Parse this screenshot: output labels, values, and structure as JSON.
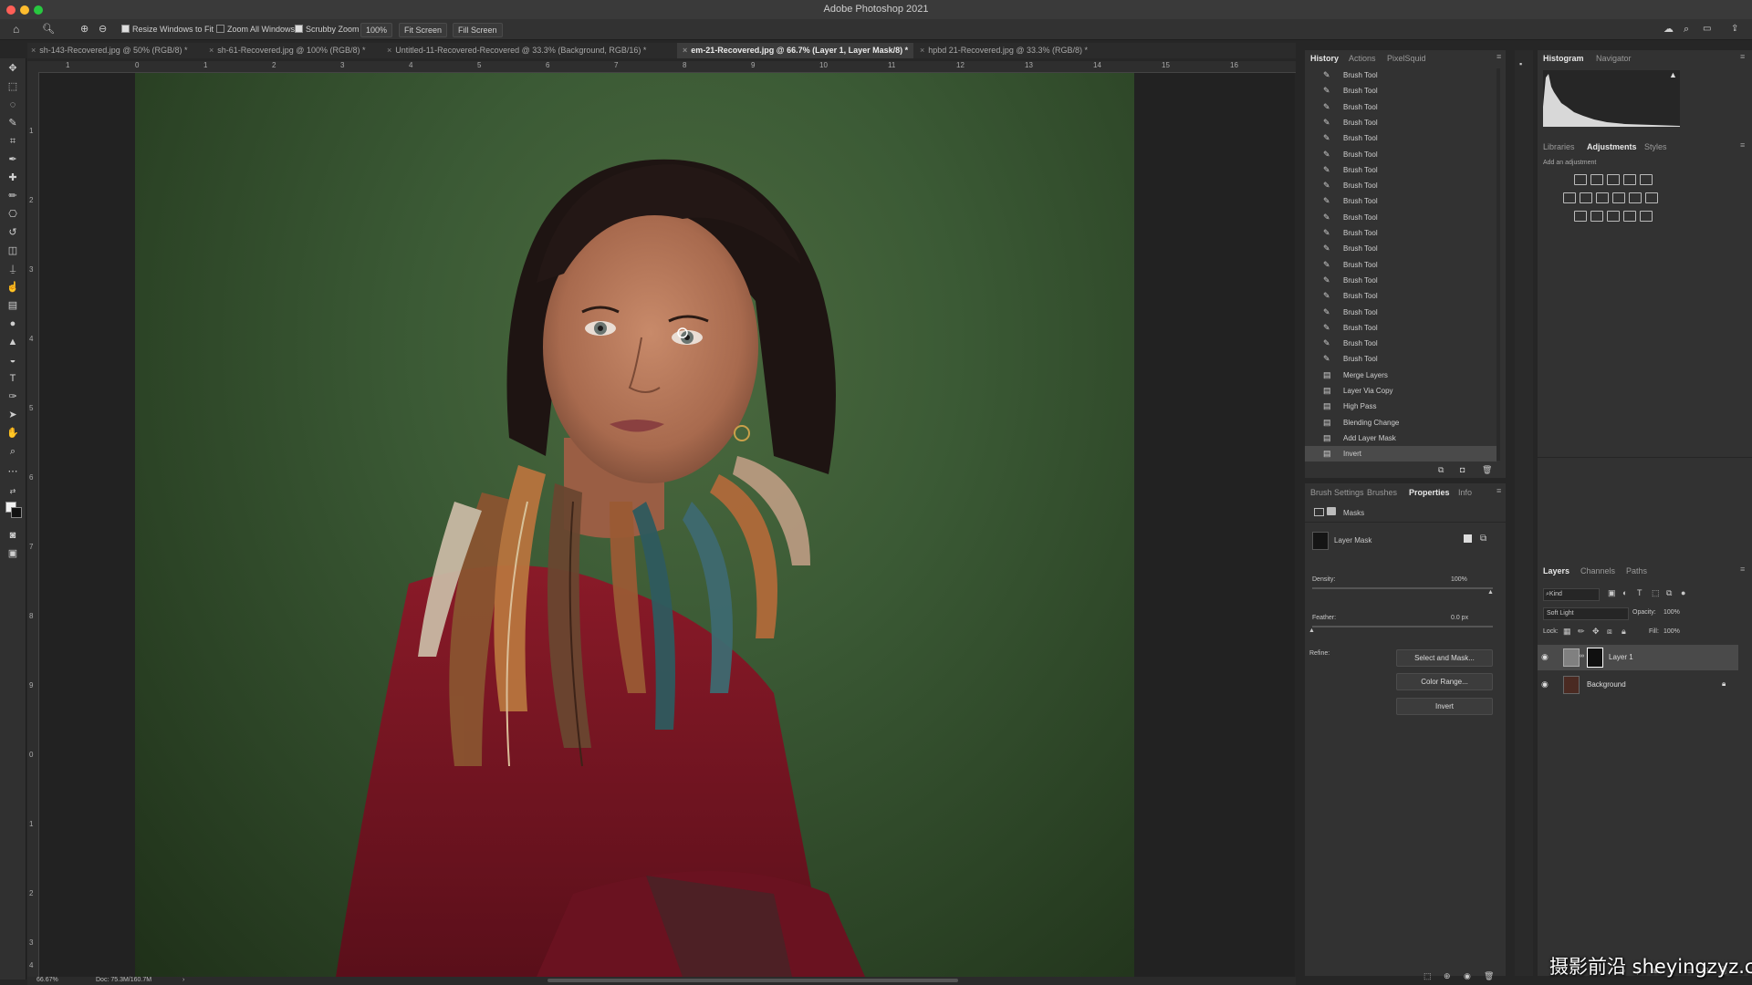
{
  "app": {
    "title": "Adobe Photoshop 2021"
  },
  "options_bar": {
    "resize_windows": "Resize Windows to Fit",
    "zoom_all": "Zoom All Windows",
    "scrubby": "Scrubby Zoom",
    "zoom_value": "100%",
    "fit_screen": "Fit Screen",
    "fill_screen": "Fill Screen"
  },
  "tabs": [
    {
      "label": "sh-143-Recovered.jpg @ 50% (RGB/8) *"
    },
    {
      "label": "sh-61-Recovered.jpg @ 100% (RGB/8) *"
    },
    {
      "label": "Untitled-11-Recovered-Recovered @ 33.3% (Background, RGB/16) *"
    },
    {
      "label": "em-21-Recovered.jpg @ 66.7% (Layer 1, Layer Mask/8) *",
      "active": true
    },
    {
      "label": "hpbd 21-Recovered.jpg @ 33.3% (RGB/8) *"
    }
  ],
  "ruler_h": [
    "1",
    "0",
    "1",
    "2",
    "3",
    "4",
    "5",
    "6",
    "7",
    "8",
    "9",
    "10",
    "11",
    "12",
    "13",
    "14",
    "15",
    "16"
  ],
  "ruler_v": [
    "1",
    "2",
    "3",
    "4",
    "5",
    "6",
    "7",
    "8",
    "9",
    "0",
    "1",
    "2",
    "3",
    "4"
  ],
  "status": {
    "zoom": "66.67%",
    "doc": "Doc: 75.3M/160.7M"
  },
  "history_panel": {
    "tabs": [
      "History",
      "Actions",
      "PixelSquid"
    ],
    "items": [
      "Brush Tool",
      "Brush Tool",
      "Brush Tool",
      "Brush Tool",
      "Brush Tool",
      "Brush Tool",
      "Brush Tool",
      "Brush Tool",
      "Brush Tool",
      "Brush Tool",
      "Brush Tool",
      "Brush Tool",
      "Brush Tool",
      "Brush Tool",
      "Brush Tool",
      "Brush Tool",
      "Brush Tool",
      "Brush Tool",
      "Brush Tool",
      "Merge Layers",
      "Layer Via Copy",
      "High Pass",
      "Blending Change",
      "Add Layer Mask",
      "Invert"
    ]
  },
  "properties_panel": {
    "tabs": [
      "Brush Settings",
      "Brushes",
      "Properties",
      "Info"
    ],
    "masks_label": "Masks",
    "layer_mask_label": "Layer Mask",
    "density_label": "Density:",
    "density_value": "100%",
    "feather_label": "Feather:",
    "feather_value": "0.0 px",
    "refine_label": "Refine:",
    "select_mask": "Select and Mask...",
    "color_range": "Color Range...",
    "invert": "Invert"
  },
  "histogram_panel": {
    "tabs": [
      "Histogram",
      "Navigator"
    ]
  },
  "adjustments_panel": {
    "tabs": [
      "Libraries",
      "Adjustments",
      "Styles"
    ],
    "add_label": "Add an adjustment"
  },
  "layers_panel": {
    "tabs": [
      "Layers",
      "Channels",
      "Paths"
    ],
    "kind": "Kind",
    "blend_mode": "Soft Light",
    "opacity_label": "Opacity:",
    "opacity_value": "100%",
    "lock_label": "Lock:",
    "fill_label": "Fill:",
    "fill_value": "100%",
    "layers": [
      {
        "name": "Layer 1",
        "selected": true
      },
      {
        "name": "Background",
        "locked": true
      }
    ]
  },
  "watermark": "摄影前沿 sheyingzyz.com"
}
